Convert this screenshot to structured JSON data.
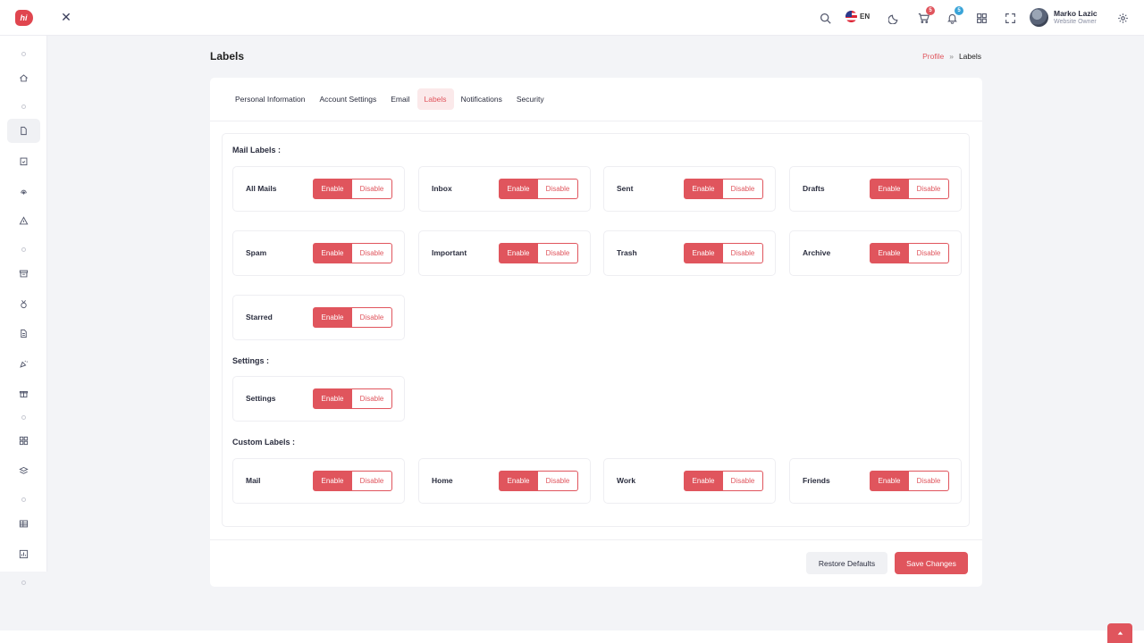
{
  "header": {
    "brand_text": "hi",
    "language": "EN",
    "cart_count": "5",
    "notification_count": "5",
    "user_name": "Marko Lazic",
    "user_role": "Website Owner"
  },
  "page": {
    "title": "Labels",
    "breadcrumb": {
      "parent": "Profile",
      "separator": "»",
      "current": "Labels"
    }
  },
  "tabs": [
    {
      "label": "Personal Information"
    },
    {
      "label": "Account Settings"
    },
    {
      "label": "Email"
    },
    {
      "label": "Labels"
    },
    {
      "label": "Notifications"
    },
    {
      "label": "Security"
    }
  ],
  "toggle": {
    "enable": "Enable",
    "disable": "Disable"
  },
  "sections": {
    "mail": {
      "title": "Mail Labels :",
      "items": [
        "All Mails",
        "Inbox",
        "Sent",
        "Drafts",
        "Spam",
        "Important",
        "Trash",
        "Archive",
        "Starred"
      ]
    },
    "settings": {
      "title": "Settings :",
      "items": [
        "Settings"
      ]
    },
    "custom": {
      "title": "Custom Labels :",
      "items": [
        "Mail",
        "Home",
        "Work",
        "Friends"
      ]
    }
  },
  "actions": {
    "restore": "Restore Defaults",
    "save": "Save Changes"
  },
  "colors": {
    "accent": "#e0555d",
    "cart_badge": "#e0555d",
    "notification_badge": "#3aa4d8"
  }
}
